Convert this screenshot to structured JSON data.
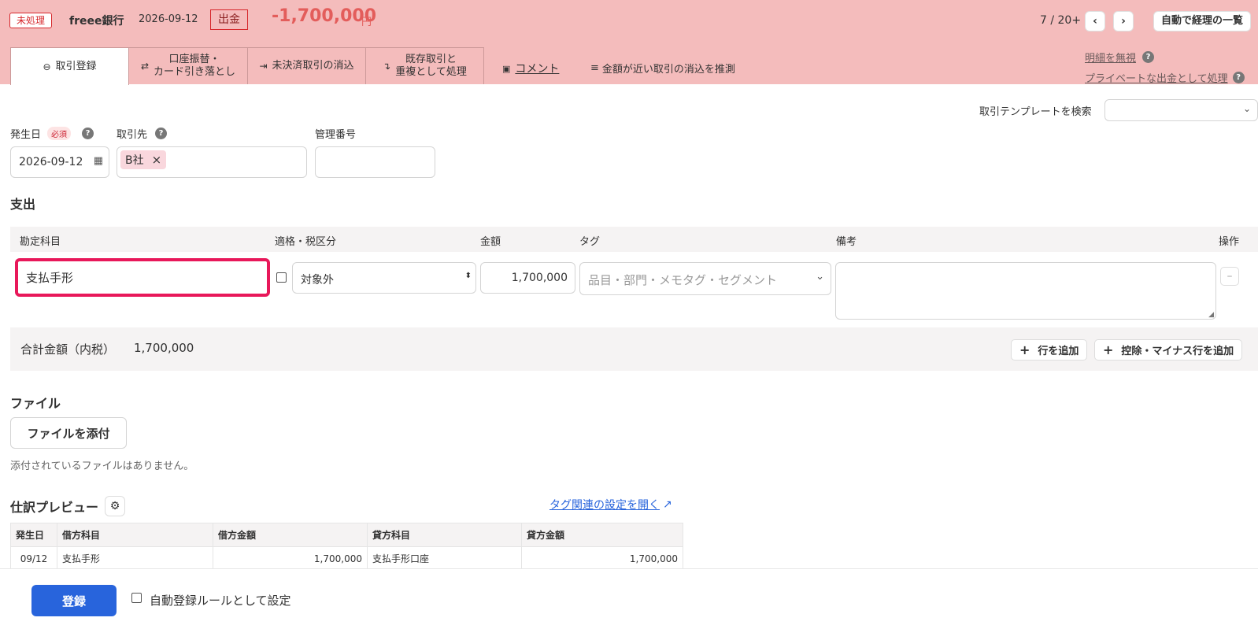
{
  "header": {
    "status_badge": "未処理",
    "bank_name": "freee銀行",
    "date": "2026-09-12",
    "direction_badge": "出金",
    "amount": "-1,700,000",
    "currency": "円",
    "pager": "7 / 20+",
    "prev_icon": "chevron-left-icon",
    "next_icon": "chevron-right-icon",
    "list_button": "自動で経理の一覧"
  },
  "tabs": [
    {
      "label": "取引登録",
      "icon": "⊖"
    },
    {
      "label": "口座振替・\nカード引き落とし",
      "icon": "⇄"
    },
    {
      "label": "未決済取引の消込",
      "icon": "⇥"
    },
    {
      "label": "既存取引と\n重複として処理",
      "icon": "↴"
    },
    {
      "label": "コメント",
      "icon": "▣"
    },
    {
      "label": "金額が近い取引の消込を推測",
      "icon": "≡"
    }
  ],
  "header_links": {
    "ignore": "明細を無視",
    "private": "プライベートな出金として処理"
  },
  "template_search": {
    "label": "取引テンプレートを検索",
    "value": ""
  },
  "form": {
    "date_label": "発生日",
    "required": "必須",
    "date_value": "2026-09-12",
    "partner_label": "取引先",
    "partner_value": "B社",
    "mgmt_label": "管理番号",
    "mgmt_value": ""
  },
  "expense": {
    "title": "支出",
    "columns": [
      "勘定科目",
      "適格・税区分",
      "金額",
      "タグ",
      "備考",
      "操作"
    ],
    "row": {
      "account": "支払手形",
      "tax": "対象外",
      "amount": "1,700,000",
      "tag_placeholder": "品目・部門・メモタグ・セグメント",
      "note": ""
    },
    "total_label": "合計金額（内税）",
    "total_value": "1,700,000",
    "add_row": "行を追加",
    "add_minus_row": "控除・マイナス行を追加"
  },
  "file": {
    "title": "ファイル",
    "attach_button": "ファイルを添付",
    "no_file": "添付されているファイルはありません。"
  },
  "preview": {
    "title": "仕訳プレビュー",
    "tag_link": "タグ関連の設定を開く",
    "columns": [
      "発生日",
      "借方科目",
      "借方金額",
      "貸方科目",
      "貸方金額"
    ],
    "rows": [
      [
        "09/12",
        "支払手形",
        "1,700,000",
        "支払手形口座",
        "1,700,000"
      ]
    ]
  },
  "footer": {
    "submit": "登録",
    "auto_rule": "自動登録ルールとして設定"
  },
  "colors": {
    "header_bg": "#f4bcbc",
    "accent_red": "#d6272b",
    "primary_blue": "#2864dc",
    "highlight": "#e8185a"
  }
}
